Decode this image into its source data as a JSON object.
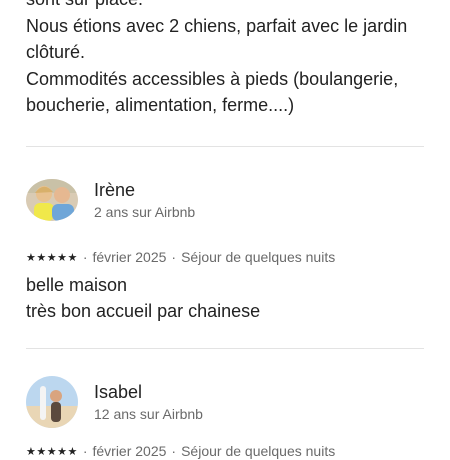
{
  "top_review": {
    "lines": [
      "sont sur place.",
      "Nous étions avec 2 chiens, parfait avec le jardin",
      "clôturé.",
      "Commodités accessibles à pieds (boulangerie,",
      "boucherie, alimentation, ferme....)"
    ]
  },
  "reviews": [
    {
      "name": "Irène",
      "since": "2 ans sur Airbnb",
      "stars": "★★★★★",
      "date": "février 2025",
      "stay": "Séjour de quelques nuits",
      "lines": [
        "belle maison",
        "très bon accueil par chainese"
      ]
    },
    {
      "name": "Isabel",
      "since": "12 ans sur Airbnb",
      "stars": "★★★★★",
      "date": "février 2025",
      "stay": "Séjour de quelques nuits",
      "lines": []
    }
  ],
  "colors": {
    "text": "#222222",
    "muted": "#6a6a6a",
    "divider": "#e3e3e3"
  }
}
